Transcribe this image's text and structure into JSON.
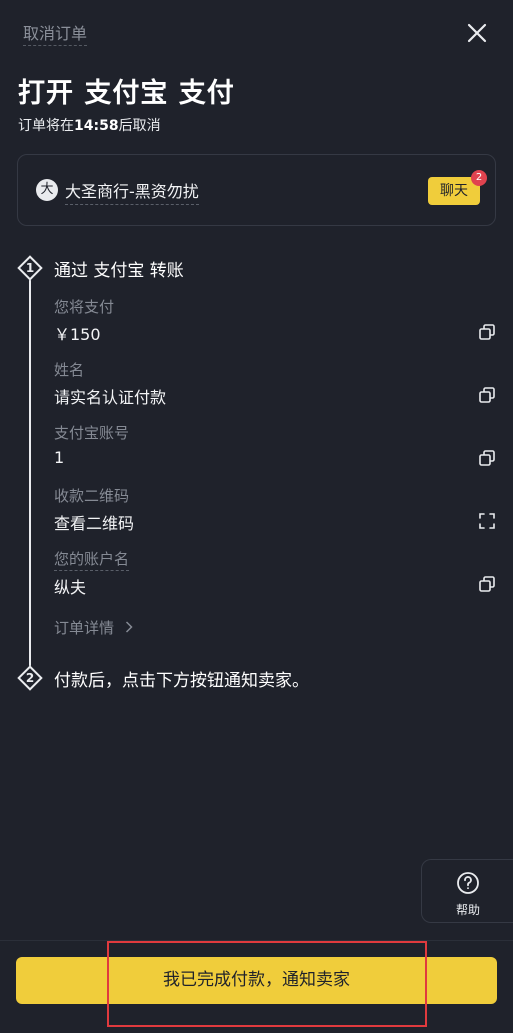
{
  "header": {
    "cancel_label": "取消订单",
    "close_icon": "close-icon"
  },
  "title": "打开 支付宝 支付",
  "countdown": {
    "prefix": "订单将在",
    "time": "14:58",
    "suffix": "后取消"
  },
  "merchant": {
    "avatar_char": "大",
    "name": "大圣商行-黑资勿扰",
    "chat_label": "聊天",
    "chat_badge": "2"
  },
  "steps": [
    {
      "number": "1",
      "title": "通过 支付宝 转账"
    },
    {
      "number": "2",
      "title": "付款后，点击下方按钮通知卖家。"
    }
  ],
  "fields": [
    {
      "label": "您将支付",
      "value": "￥150",
      "action_icon": "copy-icon"
    },
    {
      "label": "姓名",
      "value": "请实名认证付款",
      "action_icon": "copy-icon"
    },
    {
      "label": "支付宝账号",
      "value": "1",
      "action_icon": "copy-icon"
    },
    {
      "label": "收款二维码",
      "value": "查看二维码",
      "action_icon": "expand-icon"
    },
    {
      "label": "您的账户名",
      "value": "纵夫",
      "action_icon": "copy-icon"
    }
  ],
  "order_detail_label": "订单详情",
  "help": {
    "label": "帮助",
    "icon": "help-circle-icon"
  },
  "primary_button_label": "我已完成付款，通知卖家",
  "colors": {
    "background": "#1f222b",
    "accent_yellow": "#f0cd3b",
    "badge_red": "#e0434f",
    "highlight_red": "#e03a3e",
    "muted_text": "#858a94"
  }
}
